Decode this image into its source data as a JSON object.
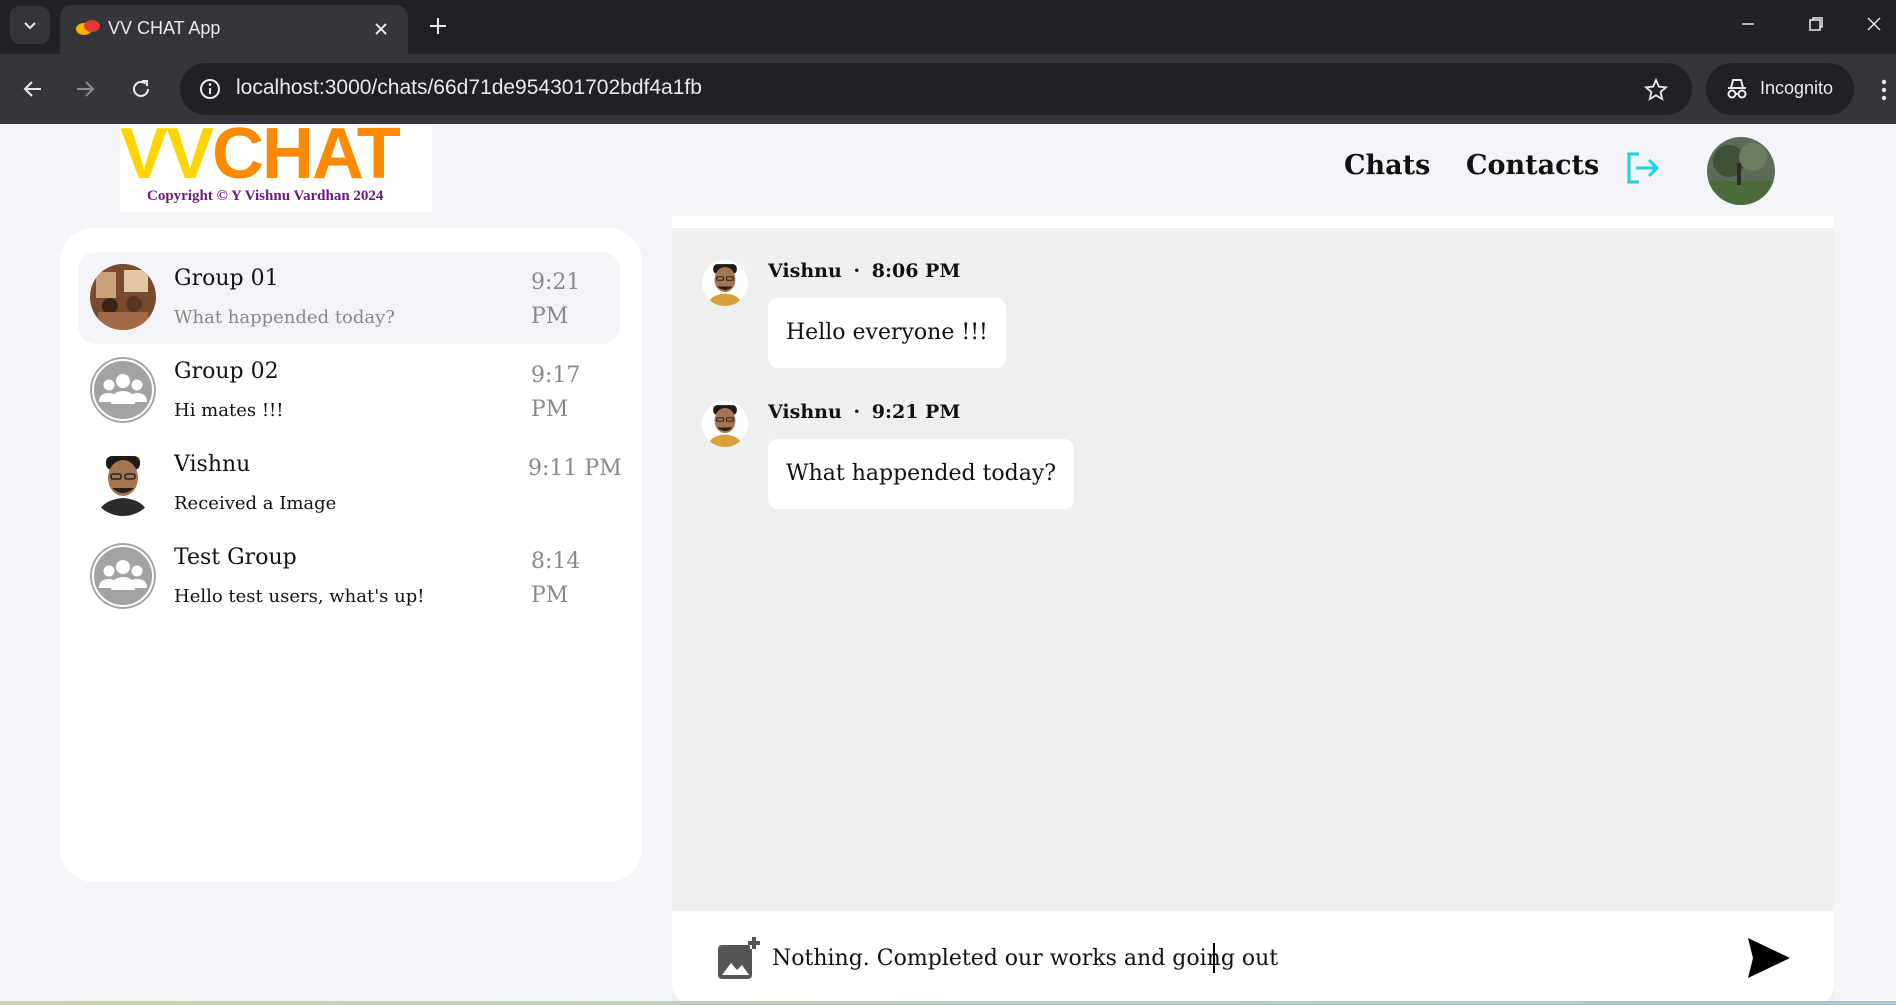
{
  "browser": {
    "tab_title": "VV CHAT App",
    "url": "localhost:3000/chats/66d71de954301702bdf4a1fb",
    "incognito_label": "Incognito"
  },
  "app": {
    "logo_vv": "VV",
    "logo_chat": "CHAT",
    "logo_copyright": "Copyright © Y Vishnu Vardhan 2024",
    "nav": {
      "chats": "Chats",
      "contacts": "Contacts"
    },
    "accent_color": "#1ed0dc"
  },
  "sidebar": {
    "chats": [
      {
        "name": "Group 01",
        "preview": "What happended today?",
        "time": "9:21 PM",
        "avatar": "group-photo",
        "active": true
      },
      {
        "name": "Group 02",
        "preview": "Hi mates !!!",
        "time": "9:17 PM",
        "avatar": "group-placeholder-icon",
        "active": false
      },
      {
        "name": "Vishnu",
        "preview": "Received a Image",
        "time": "9:11 PM",
        "avatar": "user-photo",
        "active": false
      },
      {
        "name": "Test Group",
        "preview": "Hello test users, what's up!",
        "time": "8:14 PM",
        "avatar": "group-placeholder-icon",
        "active": false
      }
    ]
  },
  "messages": [
    {
      "sender": "Vishnu",
      "separator": "·",
      "time": "8:06 PM",
      "text": "Hello everyone !!!"
    },
    {
      "sender": "Vishnu",
      "separator": "·",
      "time": "9:21 PM",
      "text": "What happended today?"
    }
  ],
  "composer": {
    "value": "Nothing. Completed our works and going out"
  }
}
